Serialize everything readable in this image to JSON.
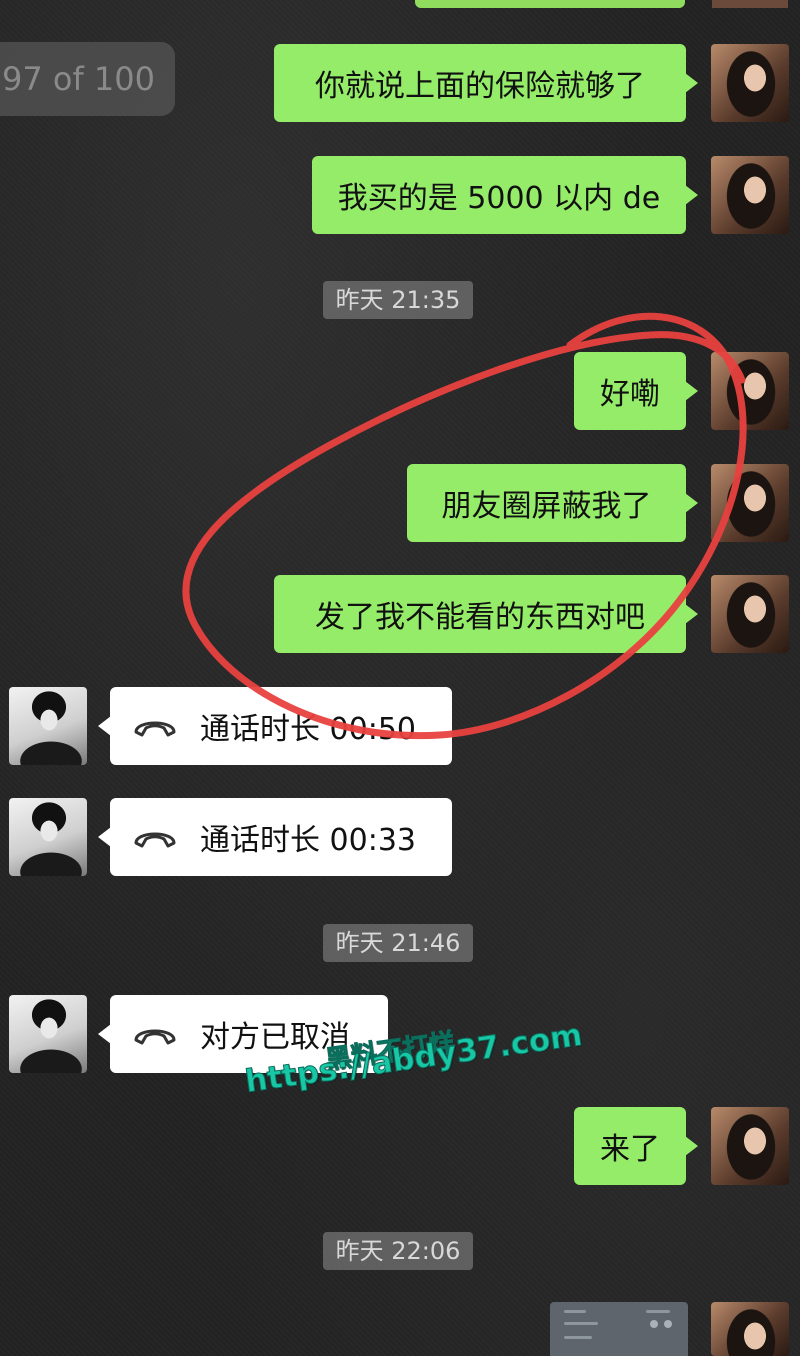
{
  "page_counter": "97 of 100",
  "messages": [
    {
      "sender": "her",
      "text": "你就说上面的保险就够了"
    },
    {
      "sender": "her",
      "text": "我买的是 5000 以内 de"
    },
    {
      "sender": "her",
      "text": "好嘞"
    },
    {
      "sender": "her",
      "text": "朋友圈屏蔽我了"
    },
    {
      "sender": "her",
      "text": "发了我不能看的东西对吧"
    },
    {
      "sender": "him",
      "text": "通话时长 00:50",
      "icon": "phone-hangup-icon"
    },
    {
      "sender": "him",
      "text": "通话时长 00:33",
      "icon": "phone-hangup-icon"
    },
    {
      "sender": "him",
      "text": "对方已取消",
      "icon": "phone-hangup-icon"
    },
    {
      "sender": "her",
      "text": "来了"
    }
  ],
  "timestamps": [
    "昨天 21:35",
    "昨天 21:46",
    "昨天 22:06"
  ],
  "watermark": {
    "line1": "黑料不打烊",
    "line2": "https://abdy37.com"
  },
  "colors": {
    "green_bubble": "#95ec69",
    "white_bubble": "#ffffff",
    "annotation_red": "#e8413f",
    "watermark": "#17c7a6"
  }
}
